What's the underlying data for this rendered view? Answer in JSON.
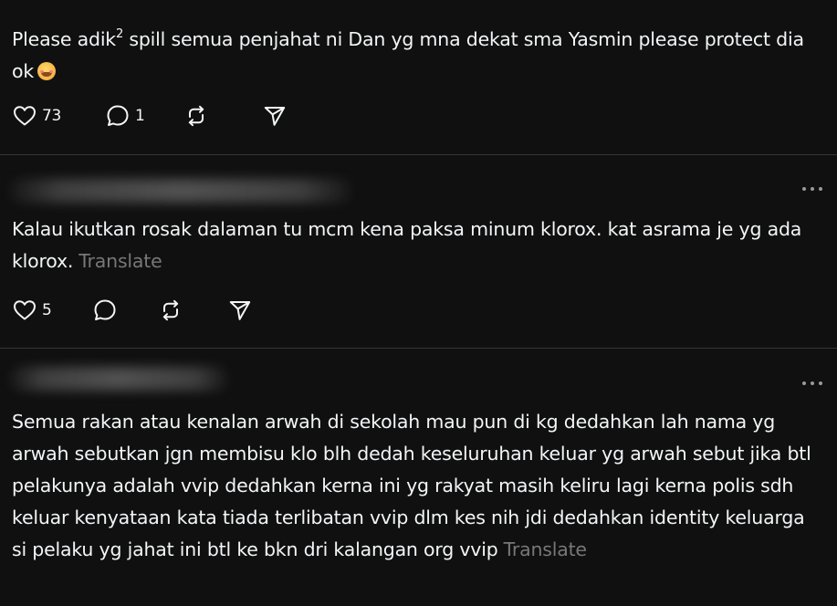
{
  "post1": {
    "text_before": "Please adik",
    "text_sup": "2",
    "text_after": " spill semua penjahat ni Dan yg mna dekat sma Yasmin please protect dia ok",
    "emoji": "pleading-face",
    "likes": "73",
    "replies": "1"
  },
  "post2": {
    "username": "",
    "text": "Kalau ikutkan rosak dalaman tu mcm kena paksa minum klorox. kat asrama je yg ada klorox.",
    "translate_label": "Translate",
    "likes": "5",
    "replies": ""
  },
  "post3": {
    "username": "",
    "text": "Semua rakan atau kenalan arwah di sekolah mau pun di kg dedahkan lah nama yg arwah sebutkan jgn membisu klo blh dedah keseluruhan keluar yg arwah sebut jika btl pelakunya adalah vvip dedahkan kerna ini yg rakyat masih keliru lagi kerna polis sdh keluar kenyataan kata tiada terlibatan vvip dlm kes nih jdi dedahkan identity keluarga si pelaku yg jahat ini btl ke bkn dri kalangan org vvip",
    "translate_label": "Translate"
  },
  "icons": {
    "like": "heart-icon",
    "reply": "comment-icon",
    "repost": "repost-icon",
    "share": "share-icon",
    "more": "more-options-icon"
  },
  "colors": {
    "background": "#101010",
    "text": "#f3f5f7",
    "muted": "#777777",
    "divider": "#333638"
  }
}
